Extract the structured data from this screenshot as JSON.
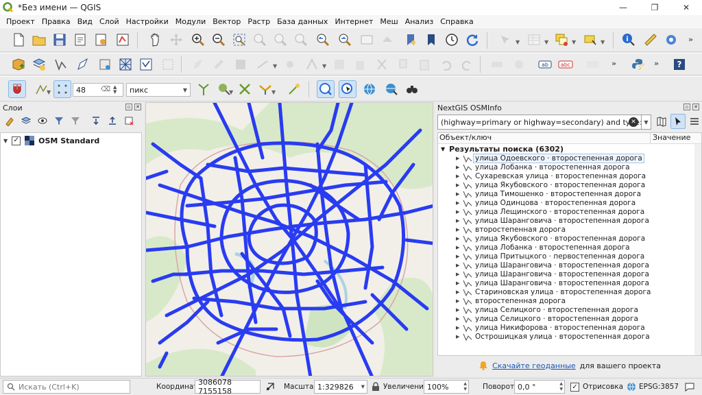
{
  "window": {
    "title": "*Без имени — QGIS",
    "minimize": "—",
    "maximize": "❐",
    "close": "✕"
  },
  "menu": [
    "Проект",
    "Правка",
    "Вид",
    "Слой",
    "Настройки",
    "Модули",
    "Вектор",
    "Растр",
    "База данных",
    "Интернет",
    "Меш",
    "Анализ",
    "Справка"
  ],
  "snapping": {
    "tolerance": "48",
    "units": "пикс"
  },
  "layers_panel": {
    "title": "Слои",
    "layers": [
      {
        "name": "OSM Standard",
        "checked": true
      }
    ]
  },
  "osm_panel": {
    "title": "NextGIS OSMInfo",
    "query": "(highway=primary or highway=secondary) and type:way",
    "columns": [
      "Объект/ключ",
      "Значение"
    ],
    "results_label": "Результаты поиска (6302)",
    "results": [
      "улица Одоевского · второстепенная дорога",
      "улица Лобанка · второстепенная дорога",
      "Сухаревская улица · второстепенная дорога",
      "улица Якубовского · второстепенная дорога",
      "улица Тимошенко · второстепенная дорога",
      "улица Одинцова · второстепенная дорога",
      "улица Лещинского · второстепенная дорога",
      "улица Шаранговича · второстепенная дорога",
      "второстепенная дорога",
      "улица Якубовского · второстепенная дорога",
      "улица Лобанка · второстепенная дорога",
      "улица Притыцкого · первостепенная дорога",
      "улица Шаранговича · второстепенная дорога",
      "улица Шаранговича · второстепенная дорога",
      "улица Шаранговича · второстепенная дорога",
      "Стариновская улица · второстепенная дорога",
      "второстепенная дорога",
      "улица Селицкого · второстепенная дорога",
      "улица Селицкого · второстепенная дорога",
      "улица Никифорова · второстепенная дорога",
      "Острошицкая улица · второстепенная дорога"
    ],
    "footer_link": "Скачайте геоданные",
    "footer_text": "для вашего проекта"
  },
  "statusbar": {
    "search_placeholder": "Искать (Ctrl+K)",
    "coord_label": "Координата",
    "coord_value": "3086078  7155158",
    "scale_label": "Масштаб",
    "scale_value": "1:329826",
    "magnifier_label": "Увеличение",
    "magnifier_value": "100%",
    "rotation_label": "Поворот",
    "rotation_value": "0,0 °",
    "render_label": "Отрисовка",
    "render_checked": true,
    "crs": "EPSG:3857"
  },
  "colors": {
    "road": "#1f33f2",
    "map_bg": "#f2efe9",
    "accent": "#1a55b5"
  }
}
